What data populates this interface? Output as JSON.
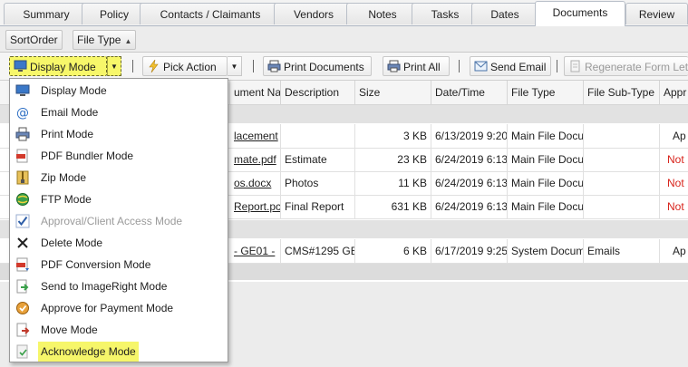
{
  "tabs": [
    {
      "label": "Summary"
    },
    {
      "label": "Policy"
    },
    {
      "label": "Contacts / Claimants"
    },
    {
      "label": "Vendors"
    },
    {
      "label": "Notes"
    },
    {
      "label": "Tasks"
    },
    {
      "label": "Dates"
    },
    {
      "label": "Documents",
      "active": true
    },
    {
      "label": "Review"
    }
  ],
  "sort": {
    "items": [
      {
        "label": "SortOrder"
      },
      {
        "label": "File Type"
      }
    ]
  },
  "toolbar": {
    "display_mode": "Display Mode",
    "pick_action": "Pick Action",
    "print_documents": "Print Documents",
    "print_all": "Print All",
    "send_email": "Send Email",
    "regenerate": "Regenerate Form Lette"
  },
  "grid": {
    "headers": [
      "",
      "ument Nar",
      "Description",
      "Size",
      "Date/Time",
      "File Type",
      "File Sub-Type",
      "Appr"
    ],
    "rows": [
      {
        "name": "lacement",
        "description": "",
        "size": "3 KB",
        "date": "6/13/2019 9:20",
        "filetype": "Main File Docu",
        "subtype": "",
        "approval": "Ap",
        "approval_red": false
      },
      {
        "name": "mate.pdf",
        "description": "Estimate",
        "size": "23 KB",
        "date": "6/24/2019 6:13",
        "filetype": "Main File Docu",
        "subtype": "",
        "approval": "Not",
        "approval_red": true
      },
      {
        "name": "os.docx",
        "description": "Photos",
        "size": "11 KB",
        "date": "6/24/2019 6:13",
        "filetype": "Main File Docu",
        "subtype": "",
        "approval": "Not",
        "approval_red": true
      },
      {
        "name": "Report.pc",
        "description": "Final Report",
        "size": "631 KB",
        "date": "6/24/2019 6:13",
        "filetype": "Main File Docu",
        "subtype": "",
        "approval": "Not",
        "approval_red": true
      },
      {
        "name": "- GE01 -",
        "description": "CMS#1295 GE",
        "size": "6 KB",
        "date": "6/17/2019 9:25",
        "filetype": "System Docum",
        "subtype": "Emails",
        "approval": "Ap",
        "approval_red": false
      }
    ]
  },
  "menu": {
    "items": [
      {
        "label": "Display Mode",
        "icon": "monitor-icon"
      },
      {
        "label": "Email Mode",
        "icon": "at-sign-icon"
      },
      {
        "label": "Print Mode",
        "icon": "printer-icon"
      },
      {
        "label": "PDF Bundler Mode",
        "icon": "pdf-icon"
      },
      {
        "label": "Zip Mode",
        "icon": "zip-icon"
      },
      {
        "label": "FTP Mode",
        "icon": "ftp-globe-icon"
      },
      {
        "label": "Approval/Client Access Mode",
        "icon": "checkbox-icon",
        "disabled": true
      },
      {
        "label": "Delete Mode",
        "icon": "x-delete-icon"
      },
      {
        "label": "PDF Conversion Mode",
        "icon": "pdf-convert-icon"
      },
      {
        "label": "Send to ImageRight Mode",
        "icon": "send-document-icon"
      },
      {
        "label": "Approve for Payment Mode",
        "icon": "approve-payment-icon"
      },
      {
        "label": "Move Mode",
        "icon": "move-document-icon"
      },
      {
        "label": "Acknowledge Mode",
        "icon": "acknowledge-icon",
        "highlighted": true
      }
    ]
  }
}
